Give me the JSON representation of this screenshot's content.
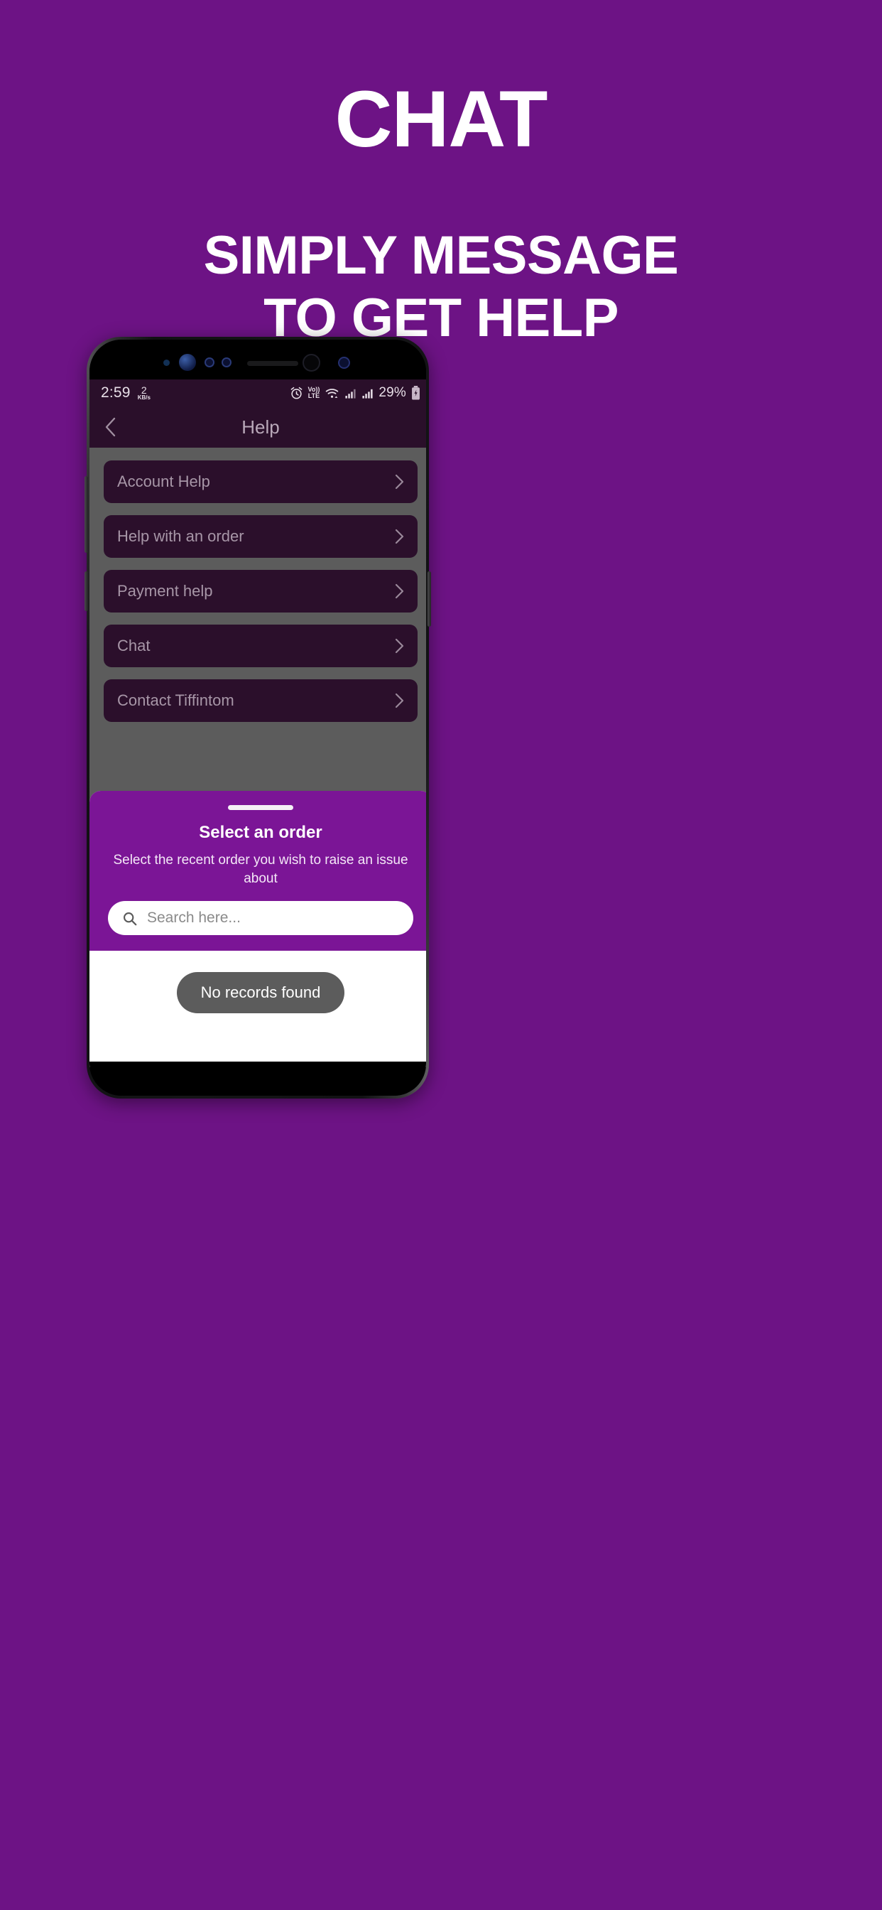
{
  "promo": {
    "title": "CHAT",
    "subtitle_line1": "SIMPLY MESSAGE",
    "subtitle_line2": "TO GET HELP",
    "background_color": "#6D1385",
    "text_color": "#FFFFFF"
  },
  "phone": {
    "status_bar": {
      "time": "2:59",
      "network_speed_value": "2",
      "network_speed_unit": "KB/s",
      "alarm_icon": "alarm-icon",
      "volte_top": "Vo))",
      "volte_bottom": "LTE",
      "wifi_icon": "wifi-icon",
      "signal_icon_sim1": "signal-bars-icon",
      "signal_icon_sim2": "signal-bars-icon",
      "battery_percent": "29%",
      "battery_icon": "battery-charging-icon",
      "background_color": "#2A0F2A",
      "foreground_color": "#E8DFE8"
    },
    "app_bar": {
      "back_icon": "chevron-left-icon",
      "title": "Help"
    },
    "help_list": {
      "items": [
        {
          "label": "Account Help",
          "chevron": "chevron-right-icon"
        },
        {
          "label": "Help with an order",
          "chevron": "chevron-right-icon"
        },
        {
          "label": "Payment help",
          "chevron": "chevron-right-icon"
        },
        {
          "label": "Chat",
          "chevron": "chevron-right-icon"
        },
        {
          "label": "Contact Tiffintom",
          "chevron": "chevron-right-icon"
        }
      ],
      "item_background": "#2B0F2B",
      "item_text_color": "#A796A7",
      "list_background": "#5C5C5C"
    },
    "bottom_sheet": {
      "handle": "drag-handle",
      "title": "Select an order",
      "subtitle": "Select the recent order you wish to raise an issue about",
      "search": {
        "icon": "search-icon",
        "value": "",
        "placeholder": "Search here..."
      },
      "empty_state": "No records found",
      "header_background": "#7B1596",
      "body_background": "#FFFFFF",
      "toast_background": "#5C5C5C"
    }
  }
}
